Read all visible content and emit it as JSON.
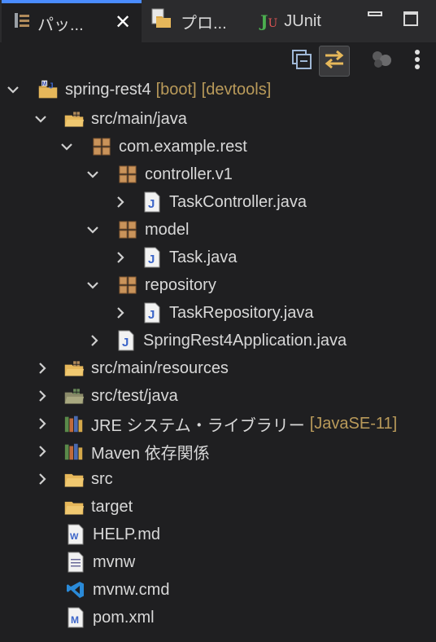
{
  "tabs": [
    {
      "label": "パッ..."
    },
    {
      "label": "プロ..."
    },
    {
      "label": "JUnit"
    }
  ],
  "tree": {
    "project": {
      "label": "spring-rest4",
      "decorations": [
        "[boot]",
        "[devtools]"
      ]
    },
    "src_main_java": {
      "label": "src/main/java"
    },
    "pkg_root": {
      "label": "com.example.rest"
    },
    "pkg_controller": {
      "label": "controller.v1"
    },
    "file_taskcontroller": {
      "label": "TaskController.java"
    },
    "pkg_model": {
      "label": "model"
    },
    "file_task": {
      "label": "Task.java"
    },
    "pkg_repository": {
      "label": "repository"
    },
    "file_taskrepository": {
      "label": "TaskRepository.java"
    },
    "file_app": {
      "label": "SpringRest4Application.java"
    },
    "src_main_resources": {
      "label": "src/main/resources"
    },
    "src_test_java": {
      "label": "src/test/java"
    },
    "jre": {
      "label": "JRE システム・ライブラリー",
      "decoration": "[JavaSE-11]"
    },
    "maven": {
      "label": "Maven 依存関係"
    },
    "src": {
      "label": "src"
    },
    "target": {
      "label": "target"
    },
    "help": {
      "label": "HELP.md"
    },
    "mvnw": {
      "label": "mvnw"
    },
    "mvnw_cmd": {
      "label": "mvnw.cmd"
    },
    "pom": {
      "label": "pom.xml"
    }
  },
  "colors": {
    "accent": "#4a8cff",
    "decoration": "#b99a5a",
    "background": "#1f1f21"
  }
}
